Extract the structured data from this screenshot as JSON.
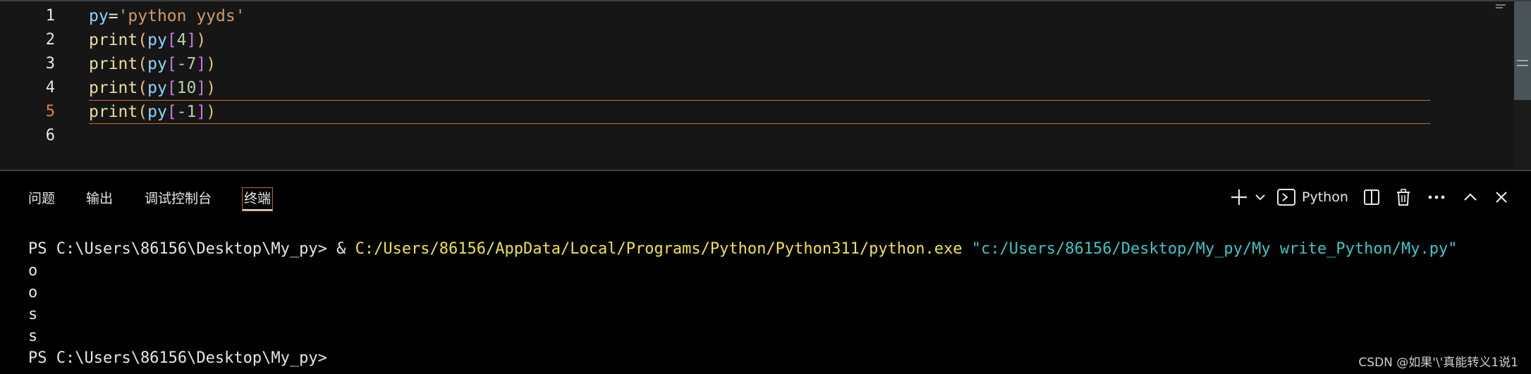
{
  "editor": {
    "lines": [
      {
        "num": "1",
        "tokens": [
          [
            "py",
            "#8fd3ff"
          ],
          [
            "=",
            "#e6e6e6"
          ],
          [
            "'python yyds'",
            "#d19a66"
          ]
        ]
      },
      {
        "num": "2",
        "tokens": [
          [
            "print",
            "#e9e09a"
          ],
          [
            "(",
            "#e5c07b"
          ],
          [
            "py",
            "#8fd3ff"
          ],
          [
            "[",
            "#c678dd"
          ],
          [
            "4",
            "#b5cea8"
          ],
          [
            "]",
            "#c678dd"
          ],
          [
            ")",
            "#e5c07b"
          ]
        ]
      },
      {
        "num": "3",
        "tokens": [
          [
            "print",
            "#e9e09a"
          ],
          [
            "(",
            "#e5c07b"
          ],
          [
            "py",
            "#8fd3ff"
          ],
          [
            "[",
            "#c678dd"
          ],
          [
            "-7",
            "#b5cea8"
          ],
          [
            "]",
            "#c678dd"
          ],
          [
            ")",
            "#e5c07b"
          ]
        ]
      },
      {
        "num": "4",
        "tokens": [
          [
            "print",
            "#e9e09a"
          ],
          [
            "(",
            "#e5c07b"
          ],
          [
            "py",
            "#8fd3ff"
          ],
          [
            "[",
            "#c678dd"
          ],
          [
            "10",
            "#b5cea8"
          ],
          [
            "]",
            "#c678dd"
          ],
          [
            ")",
            "#e5c07b"
          ]
        ]
      },
      {
        "num": "5",
        "tokens": [
          [
            "print",
            "#e9e09a"
          ],
          [
            "(",
            "#e5c07b"
          ],
          [
            "py",
            "#8fd3ff"
          ],
          [
            "[",
            "#c678dd"
          ],
          [
            "-1",
            "#b5cea8"
          ],
          [
            "]",
            "#c678dd"
          ],
          [
            ")",
            "#e5c07b"
          ]
        ]
      },
      {
        "num": "6",
        "tokens": []
      }
    ],
    "active_line": "5"
  },
  "panel": {
    "tabs": [
      {
        "label": "问题",
        "name": "tab-problems"
      },
      {
        "label": "输出",
        "name": "tab-output"
      },
      {
        "label": "调试控制台",
        "name": "tab-debug-console"
      },
      {
        "label": "终端",
        "name": "tab-terminal",
        "active": true
      }
    ],
    "toolbar": {
      "add_icon": "plus-icon",
      "dropdown_icon": "chevron-down-icon",
      "terminal_icon": "terminal-icon",
      "profile_label": "Python",
      "split_icon": "split-icon",
      "trash_icon": "trash-icon",
      "more_icon": "more-icon",
      "maximize_icon": "chevron-up-icon",
      "close_icon": "close-icon"
    }
  },
  "terminal": {
    "prompt": "PS C:\\Users\\86156\\Desktop\\My_py> ",
    "amp": "& ",
    "exe_path": "C:/Users/86156/AppData/Local/Programs/Python/Python311/python.exe",
    "script_path": "\"c:/Users/86156/Desktop/My_py/My write_Python/My.py\"",
    "outputs": [
      "o",
      "o",
      "s",
      "s"
    ],
    "final_prompt": "PS C:\\Users\\86156\\Desktop\\My_py>"
  },
  "watermark": "CSDN @如果'\\'真能转义1说1",
  "colors": {
    "exe": "#f0e443",
    "script": "#3ac8c8",
    "accent": "#c66a2a"
  }
}
